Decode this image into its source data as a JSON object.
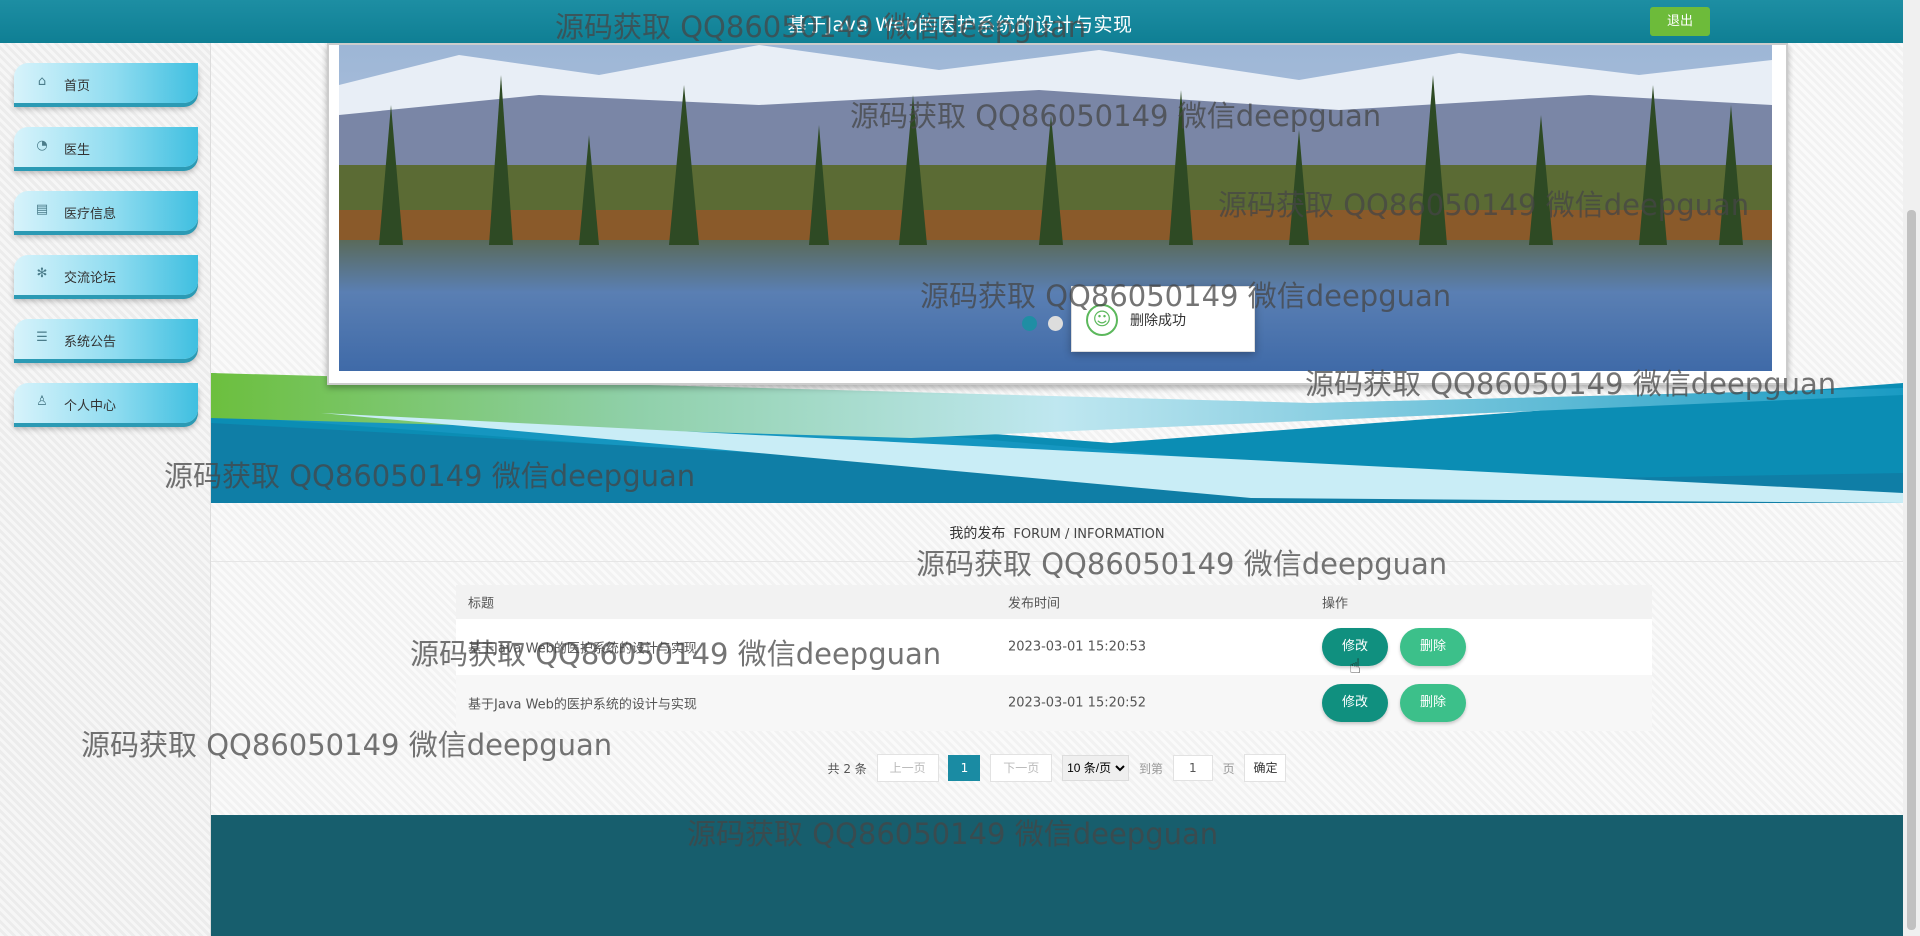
{
  "header": {
    "title": "基于Java Web的医护系统的设计与实现",
    "logout_label": "退出"
  },
  "sidebar": {
    "items": [
      {
        "label": "首页",
        "icon": "home-icon",
        "glyph": "⌂"
      },
      {
        "label": "医生",
        "icon": "dashboard-icon",
        "glyph": "◔"
      },
      {
        "label": "医疗信息",
        "icon": "printer-icon",
        "glyph": "▤"
      },
      {
        "label": "交流论坛",
        "icon": "snowflake-icon",
        "glyph": "✻"
      },
      {
        "label": "系统公告",
        "icon": "sliders-icon",
        "glyph": "☰"
      },
      {
        "label": "个人中心",
        "icon": "user-icon",
        "glyph": "♙"
      }
    ]
  },
  "banner": {
    "dots": 3,
    "active_dot": 1
  },
  "toast": {
    "message": "删除成功"
  },
  "section": {
    "title_cn": "我的发布",
    "title_en": "FORUM / INFORMATION"
  },
  "table": {
    "headers": [
      "标题",
      "发布时间",
      "操作"
    ],
    "rows": [
      {
        "title": "基于Java Web的医护系统的设计与实现",
        "time": "2023-03-01 15:20:53",
        "edit": "修改",
        "delete": "删除"
      },
      {
        "title": "基于Java Web的医护系统的设计与实现",
        "time": "2023-03-01 15:20:52",
        "edit": "修改",
        "delete": "删除"
      }
    ]
  },
  "pagination": {
    "total": "共 2 条",
    "prev": "上一页",
    "current": "1",
    "next": "下一页",
    "page_size": "10 条/页",
    "goto_label": "到第",
    "goto_value": "1",
    "page_unit": "页",
    "confirm": "确定"
  },
  "watermark": "源码获取 QQ86050149 微信deepguan",
  "colors": {
    "header": "#0f7f94",
    "logout": "#6dbb3a",
    "edit": "#10907f",
    "delete": "#3cc08a",
    "footer": "#175e6d"
  }
}
